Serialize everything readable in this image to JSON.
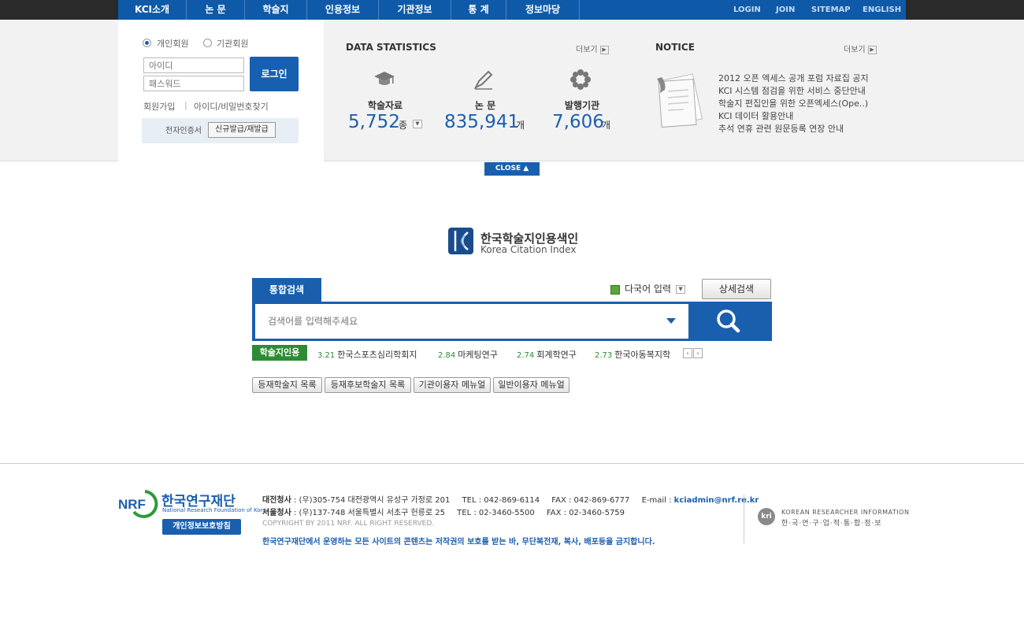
{
  "nav": {
    "items": [
      "KCI소개",
      "논 문",
      "학술지",
      "인용정보",
      "기관정보",
      "통 계",
      "정보마당"
    ],
    "util": [
      "LOGIN",
      "JOIN",
      "SITEMAP",
      "ENGLISH"
    ]
  },
  "login": {
    "radio_personal": "개인회원",
    "radio_institution": "기관회원",
    "id_placeholder": "아이디",
    "pw_placeholder": "패스워드",
    "login_button": "로그인",
    "join_link": "회원가입",
    "separator": "|",
    "find_link": "아이디/비밀번호찾기",
    "cert_label": "전자인증서",
    "cert_button": "신규발급/재발급"
  },
  "stats": {
    "title": "DATA STATISTICS",
    "more": "더보기",
    "items": [
      {
        "label": "학술자료",
        "value": "5,752",
        "unit": "종"
      },
      {
        "label": "논 문",
        "value": "835,941",
        "unit": "개"
      },
      {
        "label": "발행기관",
        "value": "7,606",
        "unit": "개"
      }
    ]
  },
  "notice": {
    "title": "NOTICE",
    "more": "더보기",
    "items": [
      "2012 오픈 엑세스 공개 포럼 자료집 공지",
      "KCI 시스템 점검을 위한 서비스 중단안내",
      "학술지 편집인을 위한 오픈엑세스(Ope..)",
      "KCI 데이터 활용안내",
      "추석 연휴 관련 원문등록 연장 안내"
    ]
  },
  "close_label": "CLOSE",
  "logo": {
    "title": "한국학술지인용색인",
    "subtitle": "Korea Citation Index"
  },
  "search": {
    "tab": "통합검색",
    "multi_lang": "다국어 입력",
    "advanced": "상세검색",
    "placeholder": "검색어를 입력해주세요"
  },
  "jci": {
    "badge": "학술지인용",
    "items": [
      {
        "score": "3.21",
        "name": "한국스포츠심리학회지"
      },
      {
        "score": "2.84",
        "name": "마케팅연구"
      },
      {
        "score": "2.74",
        "name": "회계학연구"
      },
      {
        "score": "2.73",
        "name": "한국아동복지학"
      }
    ]
  },
  "menu_buttons": [
    "등재학술지 목록",
    "등재후보학술지 목록",
    "기관이용자 메뉴얼",
    "일반이용자 메뉴얼"
  ],
  "footer": {
    "org_name": "한국연구재단",
    "org_en": "National Research Foundation of Korea",
    "privacy": "개인정보보호방침",
    "daejeon_label": "대전청사",
    "daejeon_addr": ": (우)305-754 대전광역시 유성구 가정로 201",
    "daejeon_tel": "TEL : 042-869-6114",
    "daejeon_fax": "FAX : 042-869-6777",
    "email_label": "E-mail :",
    "email": "kciadmin@nrf.re.kr",
    "seoul_label": "서울청사",
    "seoul_addr": ": (우)137-748 서울특별시 서초구 헌릉로 25",
    "seoul_tel": "TEL : 02-3460-5500",
    "seoul_fax": "FAX : 02-3460-5759",
    "copyright": "COPYRIGHT BY 2011 NRF. ALL RIGHT RESERVED.",
    "warning": "한국연구재단에서 운영하는 모든 사이트의 콘텐츠는 저작권의 보호를 받는 바, 무단복전재, 복사, 배포등을 금지합니다.",
    "kri_logo": "kri",
    "kri_en": "KOREAN RESEARCHER INFORMATION",
    "kri_ko": "한·국·연·구·업·적·통·합·정·보"
  },
  "colors": {
    "brand_blue": "#1a5fae",
    "jci_green": "#2e8b35"
  },
  "icons": [
    "graduation-cap-icon",
    "pen-icon",
    "flower-icon",
    "search-icon",
    "notice-papers-icon"
  ]
}
